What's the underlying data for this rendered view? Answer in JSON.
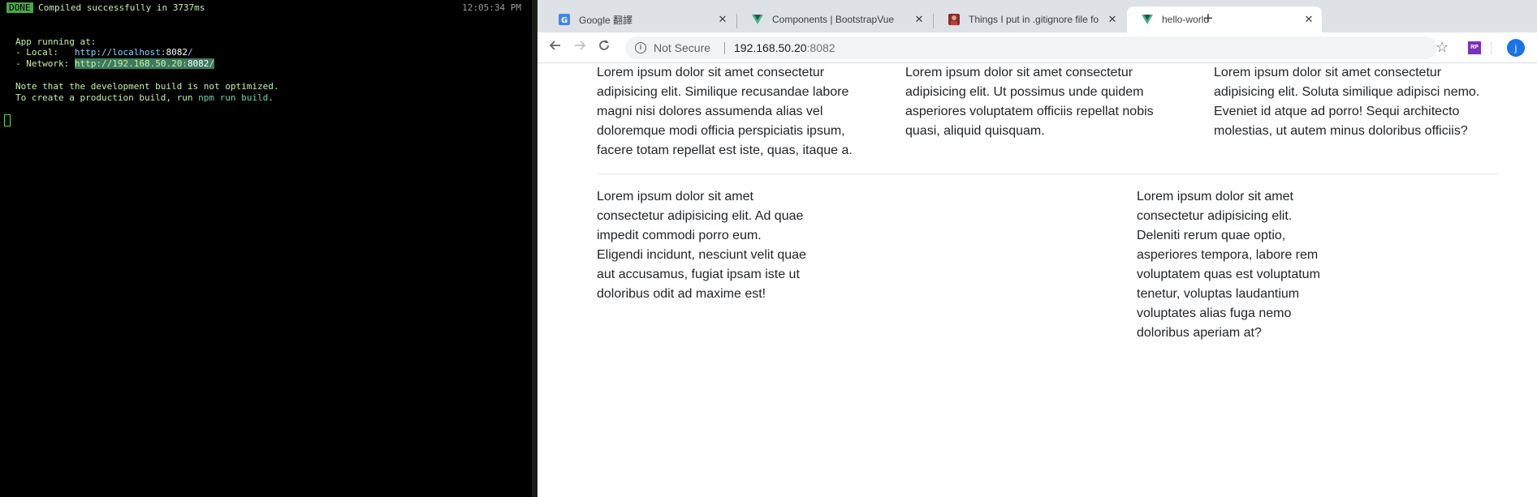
{
  "terminal": {
    "done_badge": "DONE",
    "compiled_text": "Compiled successfully in 3737ms",
    "time": "12:05:34 PM",
    "app_running": "App running at:",
    "local_label": "- Local:   ",
    "local_url_base": "http://localhost:",
    "local_port": "8082",
    "url_slash": "/",
    "network_label": "- Network: ",
    "network_url_base": "http://192.168.50.20:",
    "network_port": "8082",
    "note_line": "Note that the development build is not optimized.",
    "build_prefix": "To create a production build, run ",
    "build_cmd": "npm run build",
    "build_suffix": "."
  },
  "browser": {
    "tabs": [
      {
        "title": "Google 翻譯",
        "icon": "google-translate-icon"
      },
      {
        "title": "Components | BootstrapVue",
        "icon": "bootstrapvue-icon"
      },
      {
        "title": "Things I put in .gitignore file fo",
        "icon": "avatar-favicon-icon"
      },
      {
        "title": "hello-world",
        "icon": "vue-icon",
        "active": true
      }
    ],
    "new_tab": "+",
    "security_label": "Not Secure",
    "url_host": "192.168.50.20",
    "url_port": ":8082",
    "avatar_letter": "j",
    "extension_label": "RP"
  },
  "page": {
    "row1": [
      "Lorem ipsum dolor sit amet consectetur adipisicing elit. Similique recusandae labore magni nisi dolores assumenda alias vel doloremque modi officia perspiciatis ipsum, facere totam repellat est iste, quas, itaque a.",
      "Lorem ipsum dolor sit amet consectetur adipisicing elit. Ut possimus unde quidem asperiores voluptatem officiis repellat nobis quasi, aliquid quisquam.",
      "Lorem ipsum dolor sit amet consectetur adipisicing elit. Soluta similique adipisci nemo. Eveniet id atque ad porro! Sequi architecto molestias, ut autem minus doloribus officiis?"
    ],
    "row2": [
      "Lorem ipsum dolor sit amet consectetur adipisicing elit. Ad quae impedit commodi porro eum. Eligendi incidunt, nesciunt velit quae aut accusamus, fugiat ipsam iste ut doloribus odit ad maxime est!",
      "Lorem ipsum dolor sit amet consectetur adipisicing elit. Deleniti rerum quae optio, asperiores tempora, labore rem voluptatem quas est voluptatum tenetur, voluptas laudantium voluptates alias fuga nemo doloribus aperiam at?"
    ]
  }
}
